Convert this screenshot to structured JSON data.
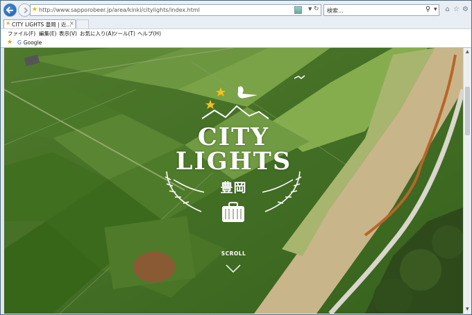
{
  "browser": {
    "url_host": "http://www.sapporobeer.jp",
    "url_path": "/area/kinki/citylights/index.html",
    "search_placeholder": "検索...",
    "tab_title": "CITY LIGHTS 豊岡 | 近..."
  },
  "menu": {
    "items": [
      "ファイル(F)",
      "編集(E)",
      "表示(V)",
      "お気に入り(A)",
      "ツール(T)",
      "ヘルプ(H)"
    ]
  },
  "favorites": {
    "items": [
      "Google"
    ]
  },
  "page": {
    "title_line1": "CITY",
    "title_line2": "LIGHTS",
    "subtitle": "豊岡",
    "scroll_label": "SCROLL"
  },
  "colors": {
    "field_dark": "#3f6a22",
    "field_light": "#6f9a3c",
    "dirt_path": "#c9b58a",
    "river": "#b8652a",
    "accent_star": "#f2c21b"
  },
  "icons": [
    "back-icon",
    "forward-icon",
    "favicon-star",
    "refresh-icon",
    "search-icon",
    "home-icon",
    "favorites-star-icon",
    "settings-gear-icon",
    "crane-logo-icon",
    "suitcase-icon",
    "scroll-arrow-icon"
  ]
}
